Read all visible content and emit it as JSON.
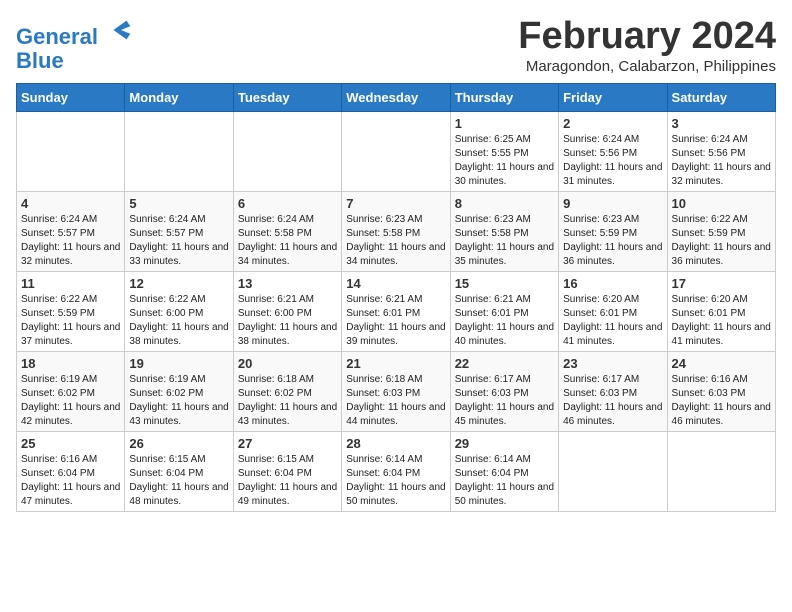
{
  "header": {
    "logo_line1": "General",
    "logo_line2": "Blue",
    "month_title": "February 2024",
    "location": "Maragondon, Calabarzon, Philippines"
  },
  "days_of_week": [
    "Sunday",
    "Monday",
    "Tuesday",
    "Wednesday",
    "Thursday",
    "Friday",
    "Saturday"
  ],
  "weeks": [
    [
      {
        "day": "",
        "sunrise": "",
        "sunset": "",
        "daylight": ""
      },
      {
        "day": "",
        "sunrise": "",
        "sunset": "",
        "daylight": ""
      },
      {
        "day": "",
        "sunrise": "",
        "sunset": "",
        "daylight": ""
      },
      {
        "day": "",
        "sunrise": "",
        "sunset": "",
        "daylight": ""
      },
      {
        "day": "1",
        "sunrise": "Sunrise: 6:25 AM",
        "sunset": "Sunset: 5:55 PM",
        "daylight": "Daylight: 11 hours and 30 minutes."
      },
      {
        "day": "2",
        "sunrise": "Sunrise: 6:24 AM",
        "sunset": "Sunset: 5:56 PM",
        "daylight": "Daylight: 11 hours and 31 minutes."
      },
      {
        "day": "3",
        "sunrise": "Sunrise: 6:24 AM",
        "sunset": "Sunset: 5:56 PM",
        "daylight": "Daylight: 11 hours and 32 minutes."
      }
    ],
    [
      {
        "day": "4",
        "sunrise": "Sunrise: 6:24 AM",
        "sunset": "Sunset: 5:57 PM",
        "daylight": "Daylight: 11 hours and 32 minutes."
      },
      {
        "day": "5",
        "sunrise": "Sunrise: 6:24 AM",
        "sunset": "Sunset: 5:57 PM",
        "daylight": "Daylight: 11 hours and 33 minutes."
      },
      {
        "day": "6",
        "sunrise": "Sunrise: 6:24 AM",
        "sunset": "Sunset: 5:58 PM",
        "daylight": "Daylight: 11 hours and 34 minutes."
      },
      {
        "day": "7",
        "sunrise": "Sunrise: 6:23 AM",
        "sunset": "Sunset: 5:58 PM",
        "daylight": "Daylight: 11 hours and 34 minutes."
      },
      {
        "day": "8",
        "sunrise": "Sunrise: 6:23 AM",
        "sunset": "Sunset: 5:58 PM",
        "daylight": "Daylight: 11 hours and 35 minutes."
      },
      {
        "day": "9",
        "sunrise": "Sunrise: 6:23 AM",
        "sunset": "Sunset: 5:59 PM",
        "daylight": "Daylight: 11 hours and 36 minutes."
      },
      {
        "day": "10",
        "sunrise": "Sunrise: 6:22 AM",
        "sunset": "Sunset: 5:59 PM",
        "daylight": "Daylight: 11 hours and 36 minutes."
      }
    ],
    [
      {
        "day": "11",
        "sunrise": "Sunrise: 6:22 AM",
        "sunset": "Sunset: 5:59 PM",
        "daylight": "Daylight: 11 hours and 37 minutes."
      },
      {
        "day": "12",
        "sunrise": "Sunrise: 6:22 AM",
        "sunset": "Sunset: 6:00 PM",
        "daylight": "Daylight: 11 hours and 38 minutes."
      },
      {
        "day": "13",
        "sunrise": "Sunrise: 6:21 AM",
        "sunset": "Sunset: 6:00 PM",
        "daylight": "Daylight: 11 hours and 38 minutes."
      },
      {
        "day": "14",
        "sunrise": "Sunrise: 6:21 AM",
        "sunset": "Sunset: 6:01 PM",
        "daylight": "Daylight: 11 hours and 39 minutes."
      },
      {
        "day": "15",
        "sunrise": "Sunrise: 6:21 AM",
        "sunset": "Sunset: 6:01 PM",
        "daylight": "Daylight: 11 hours and 40 minutes."
      },
      {
        "day": "16",
        "sunrise": "Sunrise: 6:20 AM",
        "sunset": "Sunset: 6:01 PM",
        "daylight": "Daylight: 11 hours and 41 minutes."
      },
      {
        "day": "17",
        "sunrise": "Sunrise: 6:20 AM",
        "sunset": "Sunset: 6:01 PM",
        "daylight": "Daylight: 11 hours and 41 minutes."
      }
    ],
    [
      {
        "day": "18",
        "sunrise": "Sunrise: 6:19 AM",
        "sunset": "Sunset: 6:02 PM",
        "daylight": "Daylight: 11 hours and 42 minutes."
      },
      {
        "day": "19",
        "sunrise": "Sunrise: 6:19 AM",
        "sunset": "Sunset: 6:02 PM",
        "daylight": "Daylight: 11 hours and 43 minutes."
      },
      {
        "day": "20",
        "sunrise": "Sunrise: 6:18 AM",
        "sunset": "Sunset: 6:02 PM",
        "daylight": "Daylight: 11 hours and 43 minutes."
      },
      {
        "day": "21",
        "sunrise": "Sunrise: 6:18 AM",
        "sunset": "Sunset: 6:03 PM",
        "daylight": "Daylight: 11 hours and 44 minutes."
      },
      {
        "day": "22",
        "sunrise": "Sunrise: 6:17 AM",
        "sunset": "Sunset: 6:03 PM",
        "daylight": "Daylight: 11 hours and 45 minutes."
      },
      {
        "day": "23",
        "sunrise": "Sunrise: 6:17 AM",
        "sunset": "Sunset: 6:03 PM",
        "daylight": "Daylight: 11 hours and 46 minutes."
      },
      {
        "day": "24",
        "sunrise": "Sunrise: 6:16 AM",
        "sunset": "Sunset: 6:03 PM",
        "daylight": "Daylight: 11 hours and 46 minutes."
      }
    ],
    [
      {
        "day": "25",
        "sunrise": "Sunrise: 6:16 AM",
        "sunset": "Sunset: 6:04 PM",
        "daylight": "Daylight: 11 hours and 47 minutes."
      },
      {
        "day": "26",
        "sunrise": "Sunrise: 6:15 AM",
        "sunset": "Sunset: 6:04 PM",
        "daylight": "Daylight: 11 hours and 48 minutes."
      },
      {
        "day": "27",
        "sunrise": "Sunrise: 6:15 AM",
        "sunset": "Sunset: 6:04 PM",
        "daylight": "Daylight: 11 hours and 49 minutes."
      },
      {
        "day": "28",
        "sunrise": "Sunrise: 6:14 AM",
        "sunset": "Sunset: 6:04 PM",
        "daylight": "Daylight: 11 hours and 50 minutes."
      },
      {
        "day": "29",
        "sunrise": "Sunrise: 6:14 AM",
        "sunset": "Sunset: 6:04 PM",
        "daylight": "Daylight: 11 hours and 50 minutes."
      },
      {
        "day": "",
        "sunrise": "",
        "sunset": "",
        "daylight": ""
      },
      {
        "day": "",
        "sunrise": "",
        "sunset": "",
        "daylight": ""
      }
    ]
  ]
}
